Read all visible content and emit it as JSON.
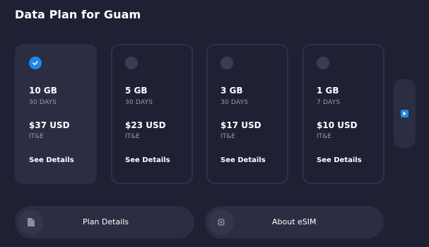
{
  "page_title": "Data Plan for Guam",
  "plans": [
    {
      "data": "10 GB",
      "days": "30 DAYS",
      "price": "$37 USD",
      "carrier": "IT&E",
      "link": "See Details",
      "selected": true
    },
    {
      "data": "5 GB",
      "days": "30 DAYS",
      "price": "$23 USD",
      "carrier": "IT&E",
      "link": "See Details",
      "selected": false
    },
    {
      "data": "3 GB",
      "days": "30 DAYS",
      "price": "$17 USD",
      "carrier": "IT&E",
      "link": "See Details",
      "selected": false
    },
    {
      "data": "1 GB",
      "days": "7 DAYS",
      "price": "$10 USD",
      "carrier": "IT&E",
      "link": "See Details",
      "selected": false
    }
  ],
  "next_icon": "play-arrow-icon",
  "bottom": {
    "plan_details_label": "Plan Details",
    "plan_details_icon": "document-icon",
    "about_esim_label": "About eSIM",
    "about_esim_icon": "chip-icon"
  },
  "colors": {
    "background": "#1e2033",
    "card_selected": "#2b2d43",
    "card_border": "#2f3148",
    "accent": "#1e88e5",
    "muted_text": "#9a9cb2"
  }
}
